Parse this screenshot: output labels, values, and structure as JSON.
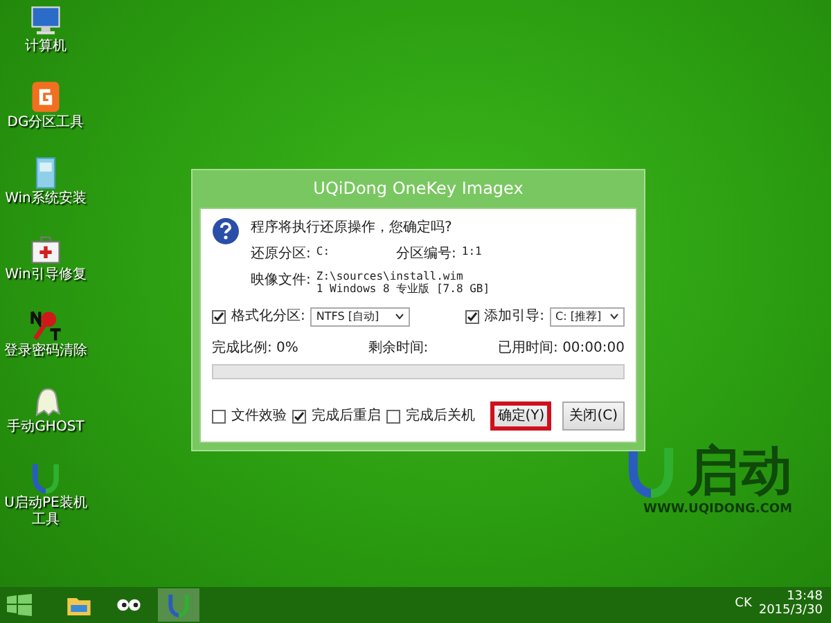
{
  "desktop_icons": [
    {
      "label": "计算机",
      "kind": "computer"
    },
    {
      "label": "DG分区工具",
      "kind": "partition"
    },
    {
      "label": "Win系统安装",
      "kind": "install"
    },
    {
      "label": "Win引导修复",
      "kind": "repair"
    },
    {
      "label": "登录密码清除",
      "kind": "password"
    },
    {
      "label": "手动GHOST",
      "kind": "ghost"
    },
    {
      "label": "U启动PE装机工具",
      "kind": "uqidong"
    }
  ],
  "dialog": {
    "title": "UQiDong OneKey Imagex",
    "question": "程序将执行还原操作，您确定吗?",
    "restore_partition": {
      "label": "还原分区:",
      "value": "C:"
    },
    "partition_number": {
      "label": "分区编号:",
      "value": "1:1"
    },
    "image_file": {
      "label": "映像文件:",
      "path": "Z:\\sources\\install.wim",
      "edition": "1 Windows 8 专业版 [7.8 GB]"
    },
    "format": {
      "label": "格式化分区:",
      "checked": true,
      "value": "NTFS [自动]"
    },
    "boot": {
      "label": "添加引导:",
      "checked": true,
      "value": "C: [推荐]"
    },
    "progress": {
      "label": "完成比例: 0%",
      "remaining": "剩余时间:",
      "elapsed": "已用时间: 00:00:00",
      "level": 0
    },
    "options": [
      {
        "label": "文件效验",
        "checked": false
      },
      {
        "label": "完成后重启",
        "checked": true
      },
      {
        "label": "完成后关机",
        "checked": false
      }
    ],
    "buttons": [
      {
        "label": "确定(Y)",
        "highlighted": true
      },
      {
        "label": "关闭(C)",
        "highlighted": false
      }
    ]
  },
  "wallpaper_logo": {
    "brand": "启动",
    "url": "WWW.UQIDONG.COM"
  },
  "taskbar": {
    "items": [
      {
        "kind": "explorer",
        "selected": false
      },
      {
        "kind": "eyes",
        "selected": false
      },
      {
        "kind": "uqidong",
        "selected": true
      }
    ],
    "tray": {
      "ime": "CK",
      "time": "13:48",
      "date": "2015/3/30"
    }
  }
}
